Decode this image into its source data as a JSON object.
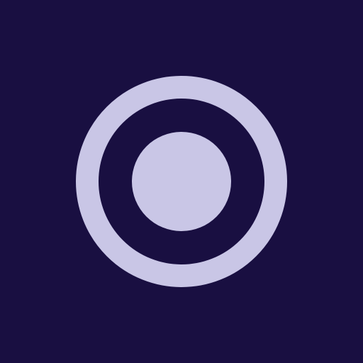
{
  "icon": {
    "name": "record-icon",
    "colors": {
      "background": "#190f41",
      "foreground": "#c9c6e6"
    }
  }
}
